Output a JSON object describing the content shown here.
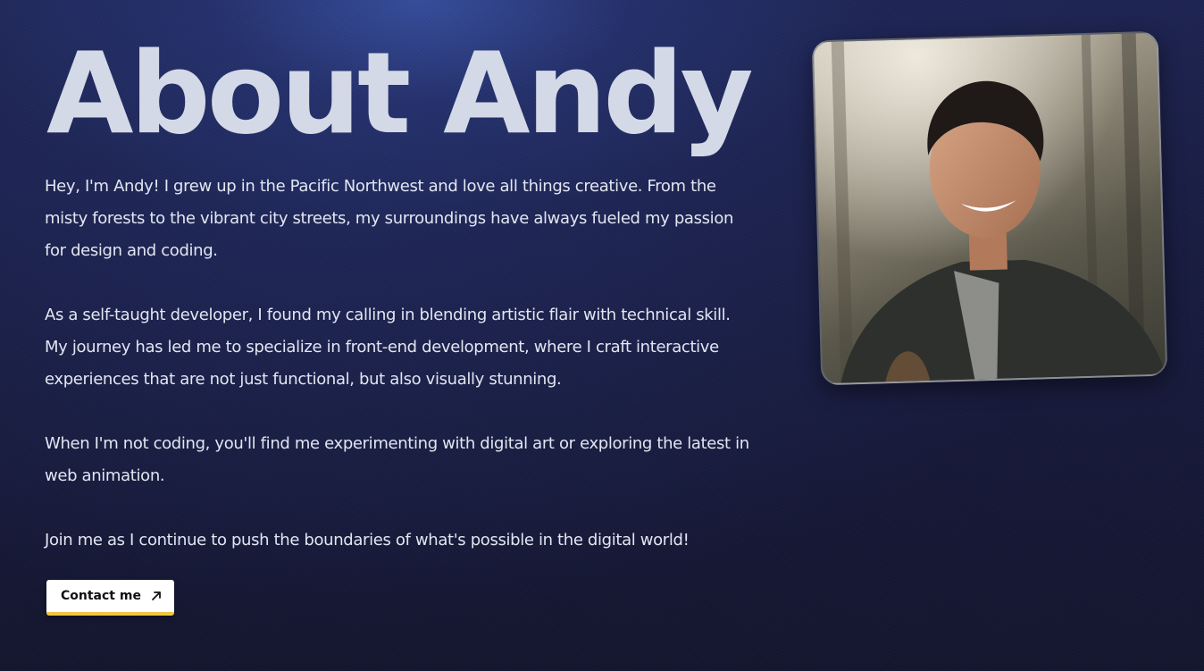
{
  "page": {
    "title": "About Andy",
    "paragraphs": [
      "Hey, I'm Andy! I grew up in the Pacific Northwest and love all things creative. From the misty forests to the vibrant city streets, my surroundings have always fueled my passion for design and coding.",
      "As a self-taught developer, I found my calling in blending artistic flair with technical skill. My journey has led me to specialize in front-end development, where I craft interactive experiences that are not just functional, but also visually stunning.",
      "When I'm not coding, you'll find me experimenting with digital art or exploring the latest in web animation.",
      "Join me as I continue to push the boundaries of what's possible in the digital world!"
    ]
  },
  "contact_button": {
    "label": "Contact me",
    "icon": "arrow-up-right-icon"
  },
  "photo": {
    "subject": "portrait-photo"
  },
  "colors": {
    "background": "#181c40",
    "title": "#d3d9e6",
    "text": "#e2e6f1",
    "button_bg": "#ffffff",
    "button_accent": "#f2c53d"
  }
}
